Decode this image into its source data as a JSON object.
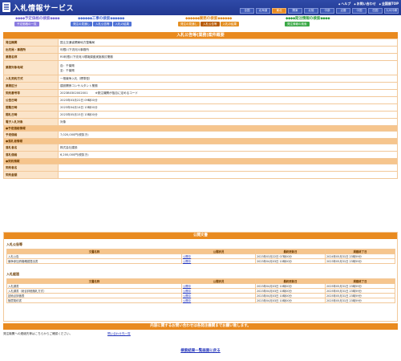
{
  "header": {
    "title": "入札情報サービス",
    "links": [
      "ヘルプ",
      "お問い合わせ",
      "全国展TOP"
    ],
    "regions": [
      "全国",
      "北海道",
      "東北",
      "関東",
      "北陸",
      "中部",
      "近畿",
      "中国",
      "四国",
      "九州沖縄"
    ],
    "active_region": "東北"
  },
  "nav": {
    "groups": [
      {
        "title": "予定価格の検索",
        "buttons": [
          "予定価格の一覧"
        ]
      },
      {
        "title": "工事の検索",
        "buttons": [
          "発注の見通し",
          "入札公告等",
          "入札の結果"
        ]
      },
      {
        "title": "業務の検索",
        "buttons": [
          "発注の見通し",
          "入札公告等",
          "入札の結果"
        ],
        "selected": "入札公告等"
      },
      {
        "title": "発注情報の検索",
        "buttons": [
          "発注情報の検索"
        ]
      }
    ]
  },
  "detail": {
    "title": "入札公告等(業務)案件概要",
    "rows": [
      {
        "label": "発注機関",
        "value": "国土交通省関東地方整備局"
      },
      {
        "label": "出先局・事務所",
        "value": "利根川下流河川事務所"
      },
      {
        "label": "業務名称",
        "value": "R5利根川下流河川環境調査実施検討業務"
      },
      {
        "label": "業務対象地域",
        "value": "自：千葉県\n至：千葉県"
      },
      {
        "label": "入札契約方式",
        "value": "一般競争入札（標準型）"
      },
      {
        "label": "業務区分",
        "value": "建設関係コンサルタント業務"
      },
      {
        "label": "契約番号等",
        "value": "2023B0302002001        ※発注機関が独自に定めるコード"
      },
      {
        "label": "公告日時",
        "value": "2023年03月22日 09時00分"
      },
      {
        "label": "閲覧日時",
        "value": "2023年04月14日 15時00分"
      },
      {
        "label": "開札日時",
        "value": "2023年05月15日 15時00分"
      },
      {
        "label": "電子入札対象",
        "value": "対象"
      }
    ],
    "estimate_header": "●予定価格情報",
    "estimate": {
      "label": "予定価格",
      "value": "7,020,000円(税抜き)"
    },
    "award_header": "●落札者情報",
    "award": [
      {
        "label": "落札者名",
        "value": "株式会社建設"
      },
      {
        "label": "落札価格",
        "value": "6,200,000円(税抜き)"
      }
    ],
    "contract_header": "●契約情報",
    "contract": [
      {
        "label": "契約者名",
        "value": ""
      },
      {
        "label": "契約金額",
        "value": ""
      }
    ]
  },
  "docs": {
    "title": "公開文書",
    "notice": {
      "title": "入札公告等",
      "headers": [
        "文書名称",
        "公開状況",
        "最終更新日",
        "掲載終了日"
      ],
      "rows": [
        [
          "入札公告",
          "公開中",
          "2023年03月22日 07時00分",
          "2024年05月31日 23時59分"
        ],
        [
          "競争参加資格確認提出書",
          "公開中",
          "2023年04月03日 10時00分",
          "2023年05月31日 23時59分"
        ]
      ]
    },
    "result": {
      "title": "入札経過",
      "headers": [
        "文書名称",
        "公開状況",
        "最終更新日",
        "掲載終了日"
      ],
      "rows": [
        [
          "入札調書",
          "公開中",
          "2023年04月03日 10時00分",
          "2025年05月31日 23時59分"
        ],
        [
          "入札調書（総合評価落札方式）",
          "公開中",
          "2023年04月03日 10時00分",
          "2025年05月31日 23時59分"
        ],
        [
          "技術点評価表",
          "公開中",
          "2023年04月03日 10時00分",
          "2025年05月31日 23時59分"
        ],
        [
          "随意契約書",
          "公開中",
          "2023年04月03日 10時00分",
          "2025年05月31日 23時59分"
        ]
      ]
    }
  },
  "inquiry": {
    "bar": "内容に関するお問い合わせは各発注機関までお願い致します。",
    "label": "発注機関への連絡先等はこちらからご確認ください。",
    "link": "問い合わせ先一覧"
  },
  "back_link": "検索結果一覧画面に戻る"
}
